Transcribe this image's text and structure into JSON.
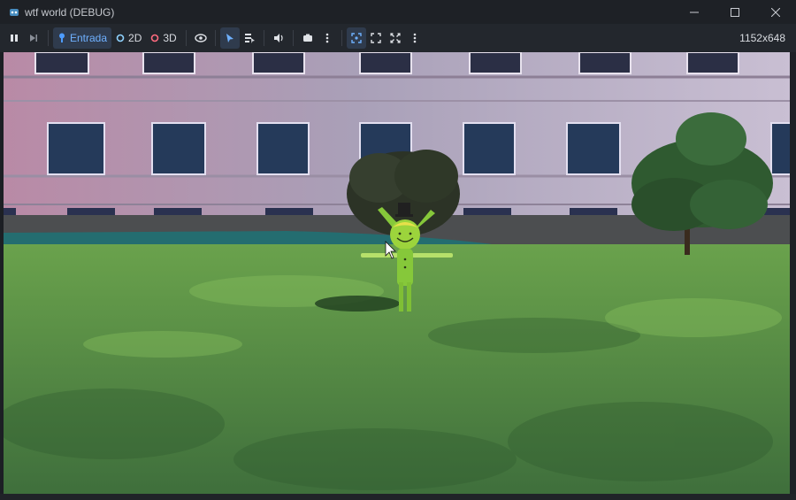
{
  "window": {
    "title": "wtf world (DEBUG)",
    "controls": [
      "minimize",
      "maximize",
      "close"
    ]
  },
  "toolbar": {
    "mode_input_label": "Entrada",
    "mode_2d_label": "2D",
    "mode_3d_label": "3D",
    "resolution": "1152x648"
  },
  "colors": {
    "accent": "#4d9cff",
    "mode_2d_dot": "#8fd3ff",
    "mode_3d_dot": "#ff6b7f"
  },
  "scene": {
    "description_icons": [
      "building-wall",
      "tree-left",
      "tree-right",
      "green-character",
      "mouse-cursor"
    ]
  }
}
